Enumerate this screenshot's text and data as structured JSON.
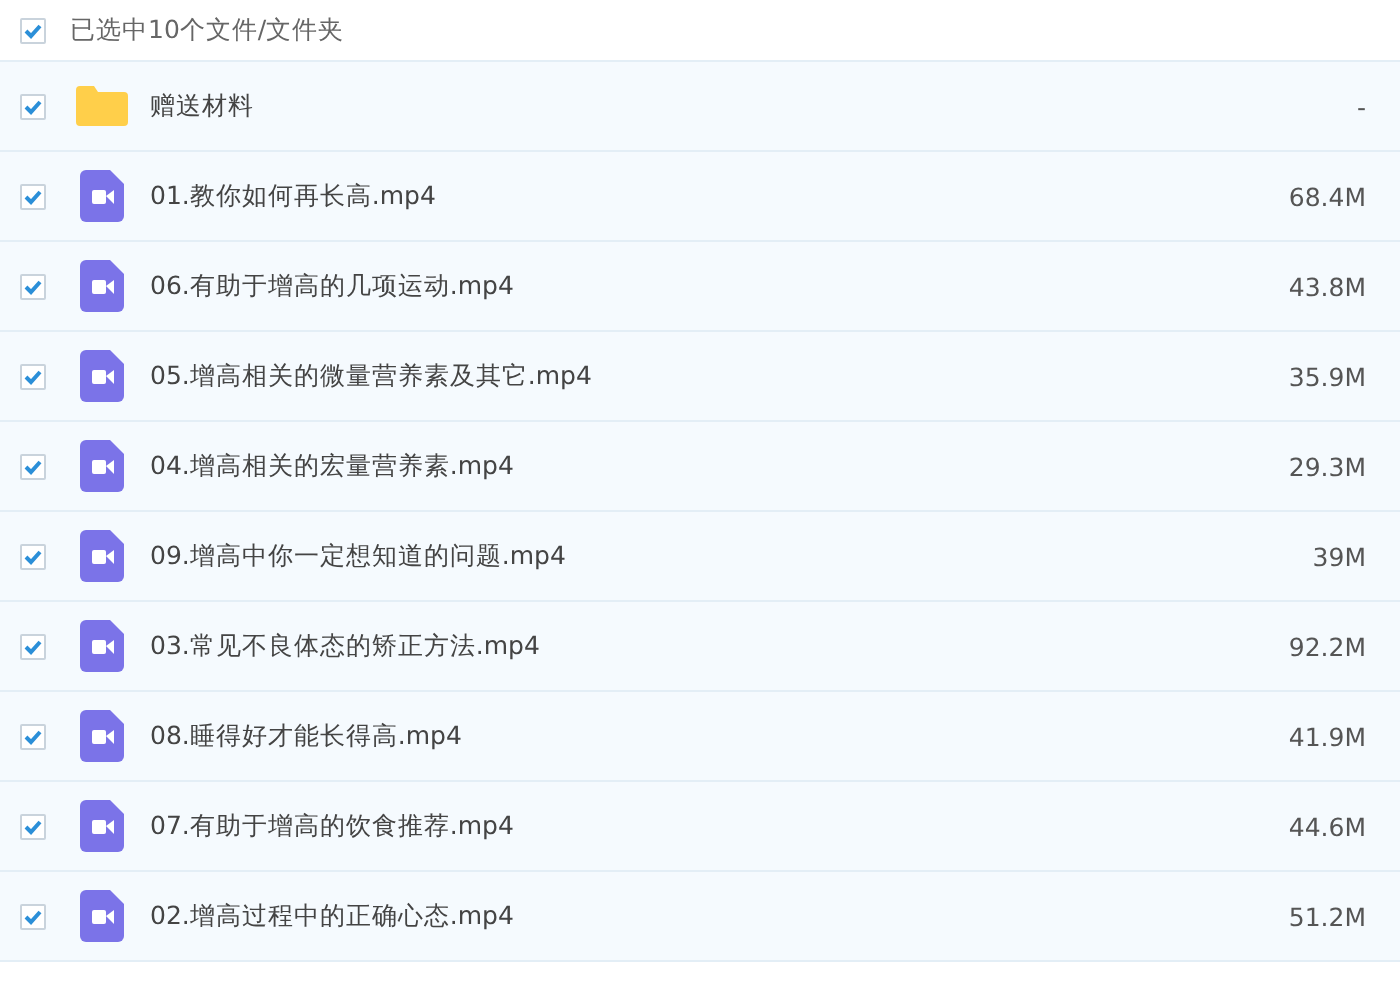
{
  "header": {
    "checked": true,
    "label": "已选中10个文件/文件夹"
  },
  "files": [
    {
      "kind": "folder",
      "name": "赠送材料",
      "size": "-",
      "checked": true
    },
    {
      "kind": "video",
      "name": "01.教你如何再长高.mp4",
      "size": "68.4M",
      "checked": true
    },
    {
      "kind": "video",
      "name": "06.有助于增高的几项运动.mp4",
      "size": "43.8M",
      "checked": true
    },
    {
      "kind": "video",
      "name": "05.增高相关的微量营养素及其它.mp4",
      "size": "35.9M",
      "checked": true
    },
    {
      "kind": "video",
      "name": "04.增高相关的宏量营养素.mp4",
      "size": "29.3M",
      "checked": true
    },
    {
      "kind": "video",
      "name": "09.增高中你一定想知道的问题.mp4",
      "size": "39M",
      "checked": true
    },
    {
      "kind": "video",
      "name": "03.常见不良体态的矫正方法.mp4",
      "size": "92.2M",
      "checked": true
    },
    {
      "kind": "video",
      "name": "08.睡得好才能长得高.mp4",
      "size": "41.9M",
      "checked": true
    },
    {
      "kind": "video",
      "name": "07.有助于增高的饮食推荐.mp4",
      "size": "44.6M",
      "checked": true
    },
    {
      "kind": "video",
      "name": "02.增高过程中的正确心态.mp4",
      "size": "51.2M",
      "checked": true
    }
  ]
}
